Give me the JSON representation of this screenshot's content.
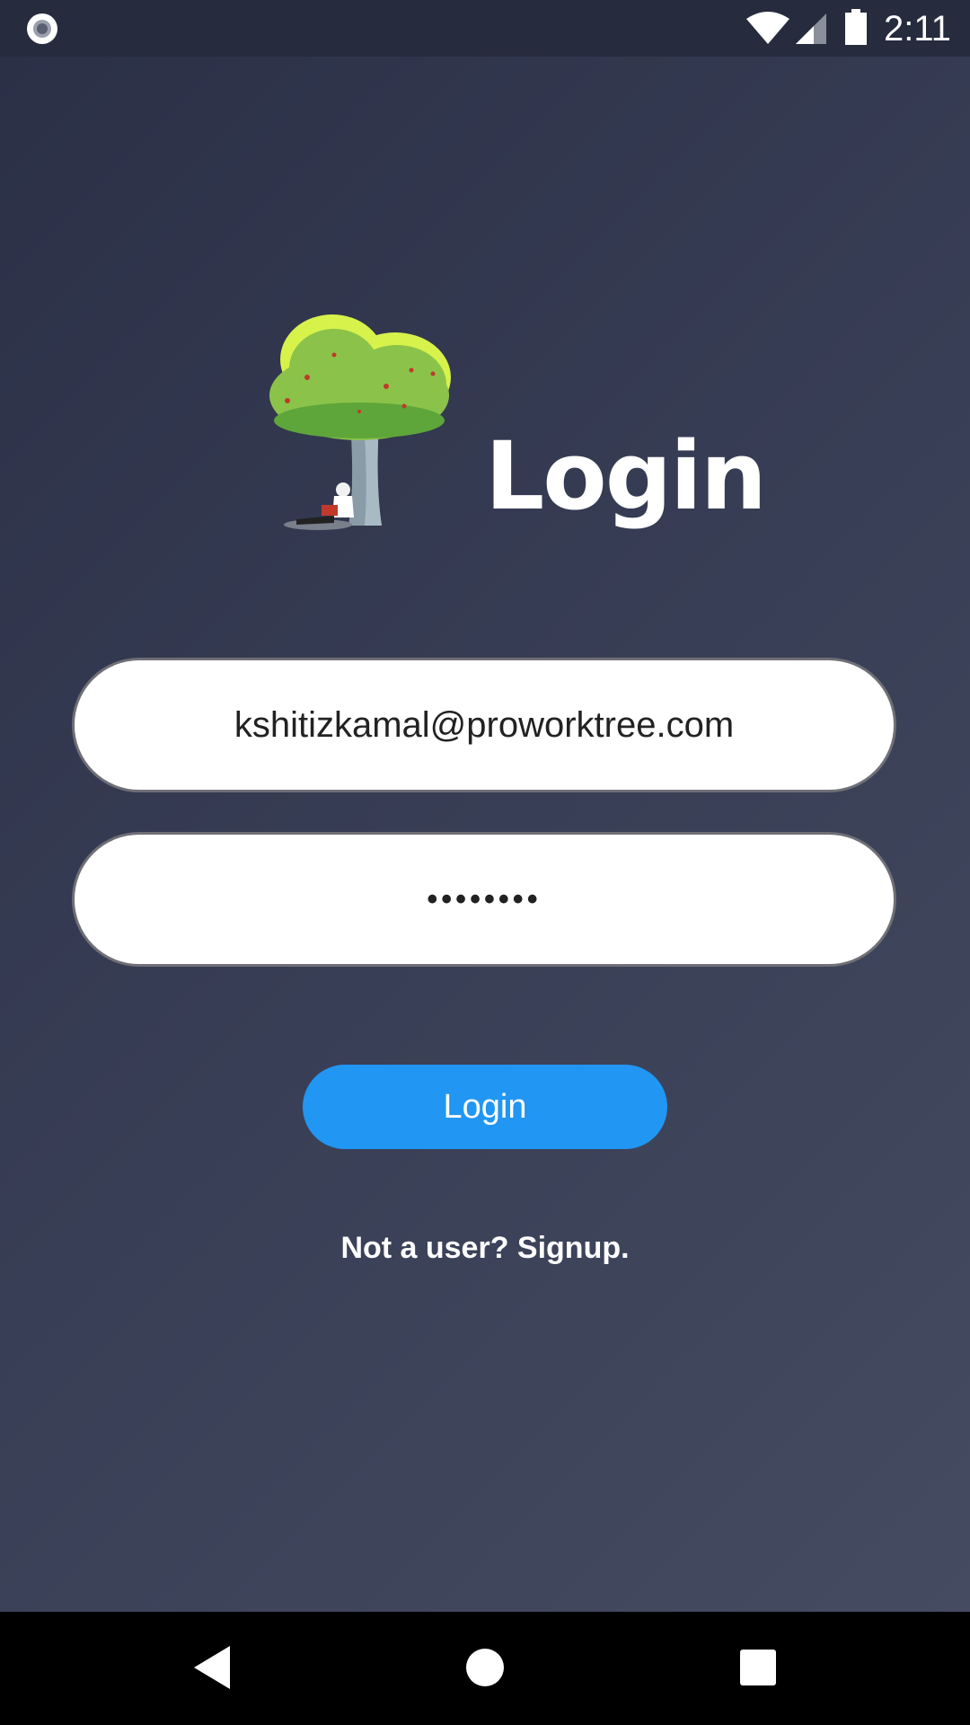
{
  "status_bar": {
    "time": "2:11",
    "icons": [
      "record-icon",
      "wifi-icon",
      "signal-icon",
      "battery-icon"
    ]
  },
  "header": {
    "title": "Login",
    "logo": "tree-logo-icon"
  },
  "form": {
    "email_value": "kshitizkamal@proworktree.com",
    "password_value": "••••••••"
  },
  "actions": {
    "login_label": "Login",
    "signup_text": "Not a user? Signup."
  },
  "nav_bar": {
    "icons": [
      "back-icon",
      "home-icon",
      "recents-icon"
    ]
  },
  "colors": {
    "accent": "#2196f3",
    "background": "#383e55",
    "status_bar": "#262b3d",
    "tree_foliage": "#8bc34a"
  }
}
